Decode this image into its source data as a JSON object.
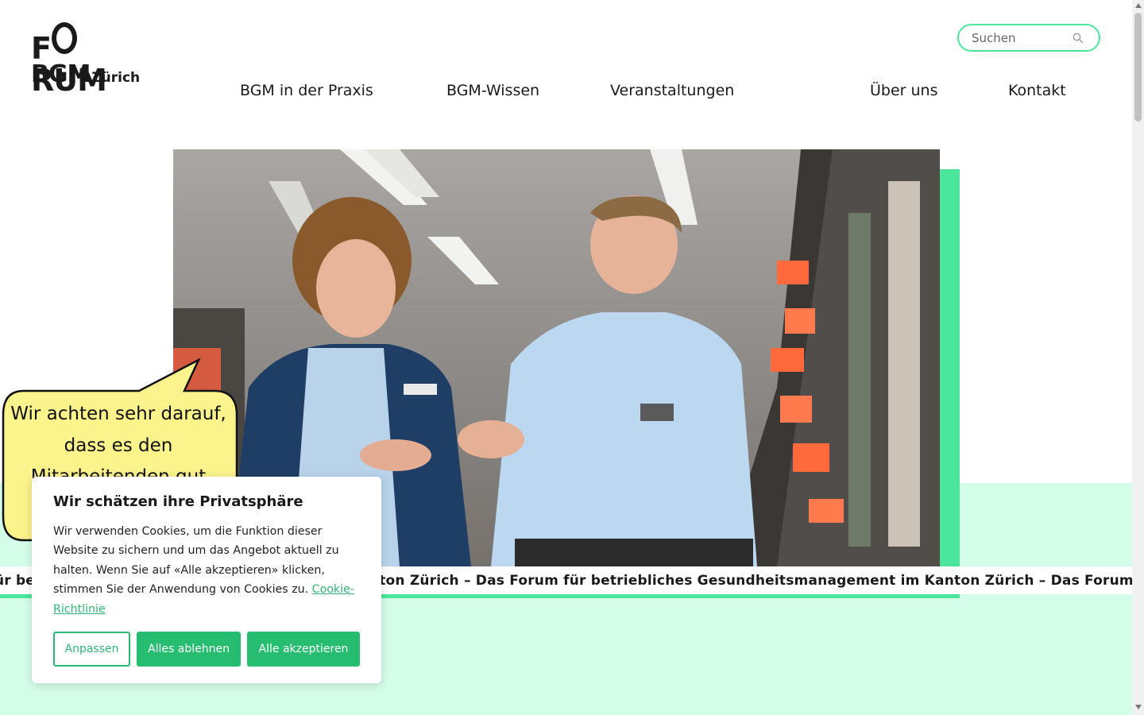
{
  "logo": {
    "line1_a": "F",
    "line1_b": "RUM",
    "line2": "BGM",
    "line2_small": "Zürich"
  },
  "search": {
    "placeholder": "Suchen",
    "icon": "search-icon"
  },
  "nav": {
    "item1": "BGM in der Praxis",
    "item2": "BGM-Wissen",
    "item3": "Veranstaltungen",
    "item4": "Über uns",
    "item5": "Kontakt"
  },
  "hero": {
    "bubble_text": "Wir achten sehr darauf, dass es den Mitarbeitenden gut",
    "ticker": "Das Forum für betriebliches Gesundheitsmanagement im Kanton Zürich – Das Forum für betriebliches Gesundheitsmanagement im Kanton Zürich – Das Forum für betriebliches Gesundheitsmanagement im Kanton Zürich – Das Forum für"
  },
  "cookie": {
    "title": "Wir schätzen ihre Privatsphäre",
    "text": "Wir verwenden Cookies, um die Funktion dieser Website zu sichern und um das Angebot aktuell zu halten. Wenn Sie auf «Alle akzeptieren» klicken, stimmen Sie der Anwendung von Cookies zu.",
    "link": "Cookie-Richtlinie",
    "btn_customize": "Anpassen",
    "btn_reject": "Alles ablehnen",
    "btn_accept": "Alle akzeptieren"
  },
  "colors": {
    "accent": "#4be69b",
    "mint": "#d4fde9",
    "button": "#26bd71",
    "bubble": "#fbf38c"
  }
}
